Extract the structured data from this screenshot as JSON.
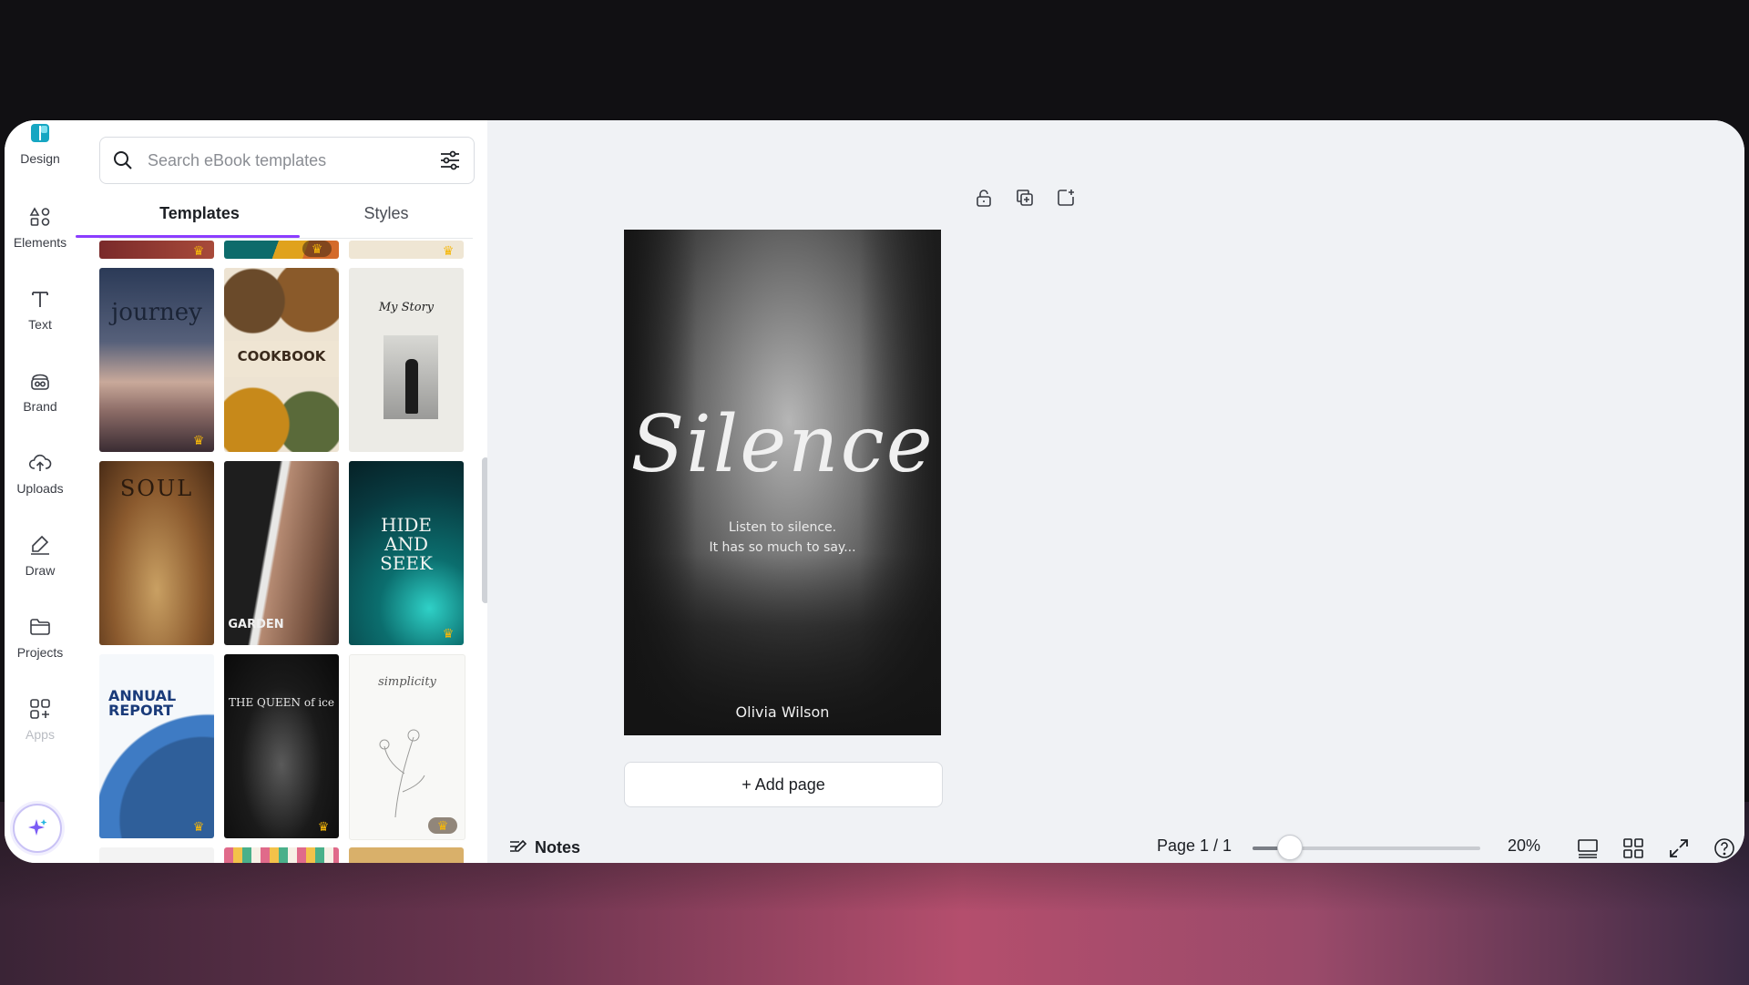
{
  "colors": {
    "accent": "#8b3dff",
    "design_icon": "#16a6c2",
    "premium_crown": "#f5b70a"
  },
  "sidebar": {
    "items": [
      {
        "label": "Design",
        "icon": "design-icon"
      },
      {
        "label": "Elements",
        "icon": "shapes-icon"
      },
      {
        "label": "Text",
        "icon": "text-icon"
      },
      {
        "label": "Brand",
        "icon": "brand-icon"
      },
      {
        "label": "Uploads",
        "icon": "cloud-upload-icon"
      },
      {
        "label": "Draw",
        "icon": "pen-icon"
      },
      {
        "label": "Projects",
        "icon": "folder-icon"
      },
      {
        "label": "Apps",
        "icon": "apps-icon"
      }
    ],
    "magic_icon": "sparkle-icon"
  },
  "search": {
    "placeholder": "Search eBook templates",
    "value": ""
  },
  "tabs": [
    {
      "label": "Templates",
      "active": true
    },
    {
      "label": "Styles",
      "active": false
    }
  ],
  "templates": [
    {
      "title": "journey",
      "premium": true
    },
    {
      "title": "COOKBOOK",
      "premium": false
    },
    {
      "title": "My Story",
      "premium": false
    },
    {
      "title": "SOUL",
      "premium": false
    },
    {
      "title": "GARDEN",
      "premium": false
    },
    {
      "title": "HIDE AND SEEK",
      "premium": true
    },
    {
      "title": "ANNUAL REPORT",
      "premium": true
    },
    {
      "title": "THE QUEEN of ice",
      "premium": true
    },
    {
      "title": "simplicity",
      "premium": true
    }
  ],
  "page_tools": [
    "lock-icon",
    "duplicate-icon",
    "add-page-icon"
  ],
  "page": {
    "title": "Silence",
    "subtitle_line1": "Listen to silence.",
    "subtitle_line2": "It has so much to say...",
    "author": "Olivia Wilson"
  },
  "add_page_label": "+ Add page",
  "footer": {
    "notes_label": "Notes",
    "page_count": "Page 1 / 1",
    "zoom_value": "20%",
    "zoom_fraction": 0.16
  }
}
